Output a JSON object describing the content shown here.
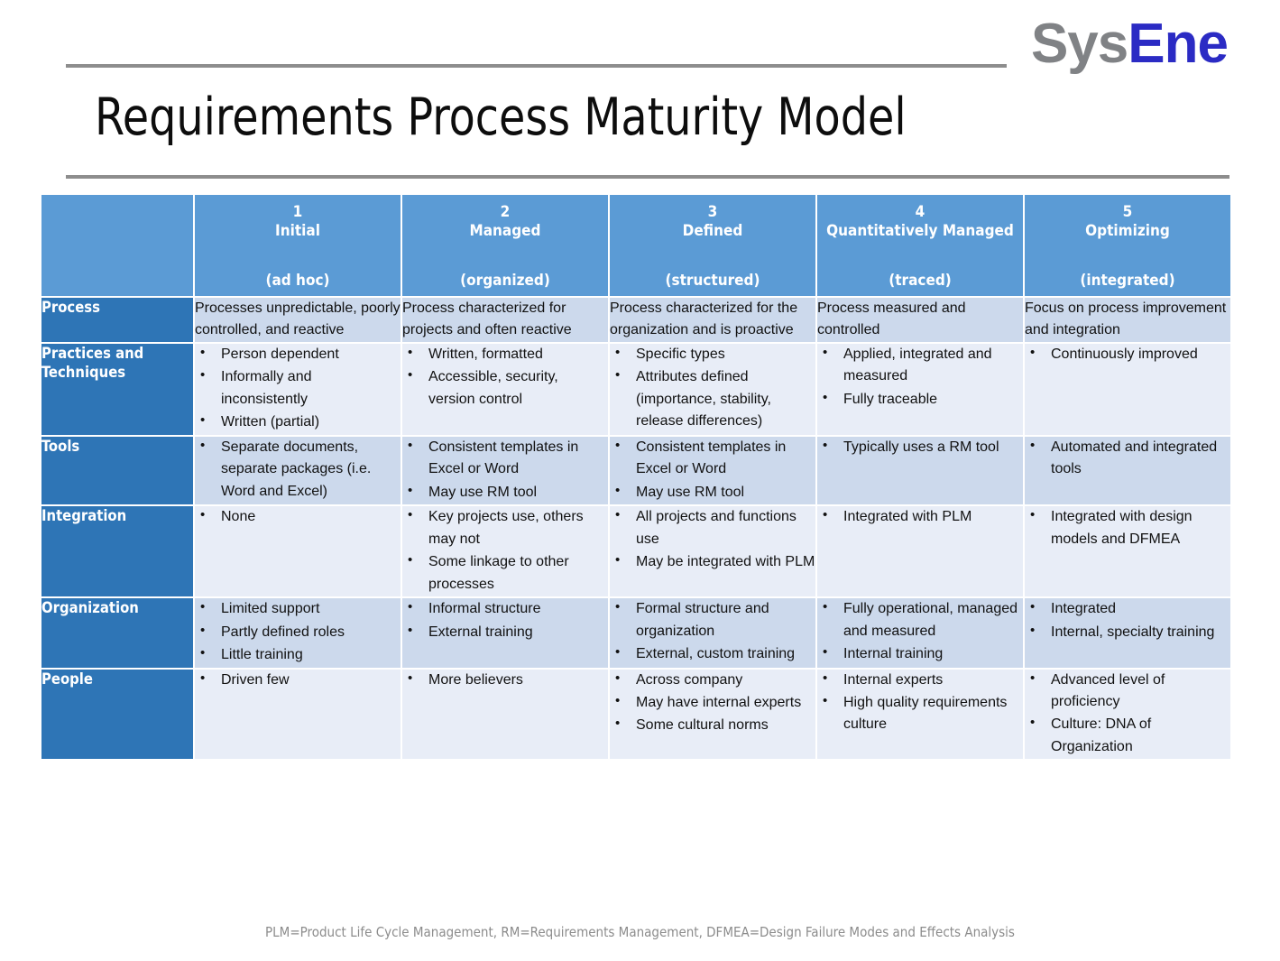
{
  "brand": {
    "part1": "Sys",
    "part2": "Ene",
    "color1": "#808285",
    "color2": "#2b2bc4"
  },
  "title": "Requirements Process Maturity Model",
  "footnote": "PLM=Product Life Cycle Management,  RM=Requirements Management, DFMEA=Design Failure Modes and Effects Analysis",
  "colors": {
    "header_blue": "#5b9bd5",
    "label_blue": "#2e75b6",
    "row_shade_dark": "#ccd9ec",
    "row_shade_light": "#e8edf7",
    "rule_gray": "#8d8d8d"
  },
  "table": {
    "corner_label": "",
    "levels": [
      {
        "number": "1",
        "name": "Initial",
        "paren": "(ad hoc)"
      },
      {
        "number": "2",
        "name": "Managed",
        "paren": "(organized)"
      },
      {
        "number": "3",
        "name": "Defined",
        "paren": "(structured)"
      },
      {
        "number": "4",
        "name": "Quantitatively Managed",
        "paren": "(traced)"
      },
      {
        "number": "5",
        "name": "Optimizing",
        "paren": "(integrated)"
      }
    ],
    "rows": [
      {
        "label": "Process",
        "cells": [
          {
            "type": "para",
            "text": "Processes unpredictable, poorly controlled, and reactive"
          },
          {
            "type": "para",
            "text": "Process characterized for projects and often reactive"
          },
          {
            "type": "para",
            "text": "Process characterized for the organization and is proactive"
          },
          {
            "type": "para",
            "text": "Process measured and controlled"
          },
          {
            "type": "para",
            "text": "Focus on process improvement and integration"
          }
        ]
      },
      {
        "label": "Practices and Techniques",
        "cells": [
          {
            "type": "list",
            "items": [
              "Person dependent",
              "Informally and inconsistently",
              "Written (partial)"
            ]
          },
          {
            "type": "list",
            "items": [
              "Written, formatted",
              "Accessible, security, version control"
            ]
          },
          {
            "type": "list",
            "items": [
              "Specific types",
              "Attributes defined (importance, stability, release differences)"
            ]
          },
          {
            "type": "list",
            "items": [
              "Applied, integrated and measured",
              "Fully traceable"
            ]
          },
          {
            "type": "list",
            "items": [
              "Continuously improved"
            ]
          }
        ]
      },
      {
        "label": "Tools",
        "cells": [
          {
            "type": "list",
            "items": [
              "Separate documents, separate packages (i.e. Word and Excel)"
            ]
          },
          {
            "type": "list",
            "items": [
              "Consistent templates in Excel or Word",
              "May use RM tool"
            ]
          },
          {
            "type": "list",
            "items": [
              "Consistent templates in Excel or Word",
              "May use RM tool"
            ]
          },
          {
            "type": "list",
            "items": [
              "Typically uses a RM tool"
            ]
          },
          {
            "type": "list",
            "items": [
              "Automated and integrated tools"
            ]
          }
        ]
      },
      {
        "label": "Integration",
        "cells": [
          {
            "type": "list",
            "items": [
              "None"
            ]
          },
          {
            "type": "list",
            "items": [
              "Key projects use, others may not",
              "Some linkage to other processes"
            ]
          },
          {
            "type": "list",
            "items": [
              "All projects and functions use",
              "May be integrated with PLM"
            ]
          },
          {
            "type": "list",
            "items": [
              "Integrated with PLM"
            ]
          },
          {
            "type": "list",
            "items": [
              "Integrated with design models and DFMEA"
            ]
          }
        ]
      },
      {
        "label": "Organization",
        "cells": [
          {
            "type": "list",
            "items": [
              "Limited support",
              "Partly defined roles",
              "Little training"
            ]
          },
          {
            "type": "list",
            "items": [
              "Informal structure",
              "External training"
            ]
          },
          {
            "type": "list",
            "items": [
              "Formal structure and organization",
              "External, custom training"
            ]
          },
          {
            "type": "list",
            "items": [
              "Fully operational, managed and measured",
              "Internal training"
            ]
          },
          {
            "type": "list",
            "items": [
              "Integrated",
              "Internal, specialty training"
            ]
          }
        ]
      },
      {
        "label": "People",
        "cells": [
          {
            "type": "list",
            "items": [
              "Driven few"
            ]
          },
          {
            "type": "list",
            "items": [
              "More believers"
            ]
          },
          {
            "type": "list",
            "items": [
              "Across company",
              "May have internal experts",
              "Some cultural norms"
            ]
          },
          {
            "type": "list",
            "items": [
              "Internal experts",
              "High quality requirements culture"
            ]
          },
          {
            "type": "list",
            "items": [
              "Advanced level of proficiency",
              "Culture: DNA of Organization"
            ]
          }
        ]
      }
    ]
  }
}
